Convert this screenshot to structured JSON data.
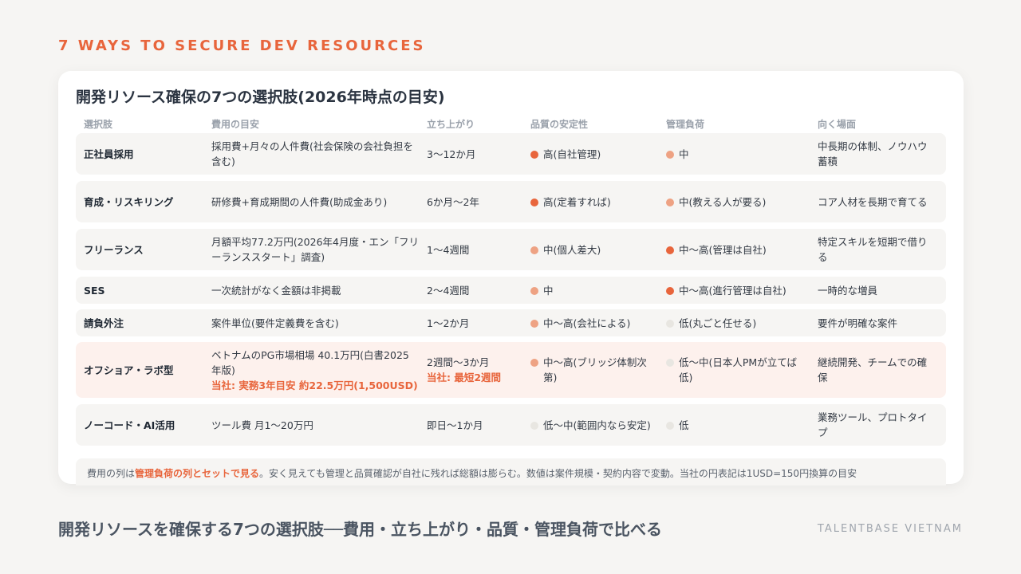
{
  "eyebrow": "7 WAYS TO SECURE DEV RESOURCES",
  "card_title": "開発リソース確保の7つの選択肢(2026年時点の目安)",
  "headers": [
    "選択肢",
    "費用の目安",
    "立ち上がり",
    "品質の安定性",
    "管理負荷",
    "向く場面"
  ],
  "colors": {
    "high": "#e8653c",
    "mid": "#eea283",
    "low": "#e8e6e1",
    "accent": "#e8653c"
  },
  "rows": [
    {
      "name": "正社員採用",
      "cost": "採用費+月々の人件費(社会保険の会社負担を含む)",
      "cost_extra": "",
      "ramp": "3〜12か月",
      "ramp_extra": "",
      "quality": "高(自社管理)",
      "quality_level": "high",
      "load": "中",
      "load_level": "mid",
      "fit": "中長期の体制、ノウハウ蓄積"
    },
    {
      "name": "育成・リスキリング",
      "cost": "研修費+育成期間の人件費(助成金あり)",
      "cost_extra": "",
      "ramp": "6か月〜2年",
      "ramp_extra": "",
      "quality": "高(定着すれば)",
      "quality_level": "high",
      "load": "中(教える人が要る)",
      "load_level": "mid",
      "fit": "コア人材を長期で育てる"
    },
    {
      "name": "フリーランス",
      "cost": "月額平均77.2万円(2026年4月度・エン「フリーランススタート」調査)",
      "cost_extra": "",
      "ramp": "1〜4週間",
      "ramp_extra": "",
      "quality": "中(個人差大)",
      "quality_level": "mid",
      "load": "中〜高(管理は自社)",
      "load_level": "high",
      "fit": "特定スキルを短期で借りる"
    },
    {
      "name": "SES",
      "cost": "一次統計がなく金額は非掲載",
      "cost_extra": "",
      "ramp": "2〜4週間",
      "ramp_extra": "",
      "quality": "中",
      "quality_level": "mid",
      "load": "中〜高(進行管理は自社)",
      "load_level": "high",
      "fit": "一時的な増員"
    },
    {
      "name": "請負外注",
      "cost": "案件単位(要件定義費を含む)",
      "cost_extra": "",
      "ramp": "1〜2か月",
      "ramp_extra": "",
      "quality": "中〜高(会社による)",
      "quality_level": "mid",
      "load": "低(丸ごと任せる)",
      "load_level": "low",
      "fit": "要件が明確な案件"
    },
    {
      "name": "オフショア・ラボ型",
      "cost": "ベトナムのPG市場相場 40.1万円(白書2025年版)",
      "cost_extra": "当社: 実務3年目安 約22.5万円(1,500USD)",
      "ramp": "2週間〜3か月",
      "ramp_extra": "当社: 最短2週間",
      "quality": "中〜高(ブリッジ体制次第)",
      "quality_level": "mid",
      "load": "低〜中(日本人PMが立てば低)",
      "load_level": "low",
      "fit": "継続開発、チームでの確保"
    },
    {
      "name": "ノーコード・AI活用",
      "cost": "ツール費 月1〜20万円",
      "cost_extra": "",
      "ramp": "即日〜1か月",
      "ramp_extra": "",
      "quality": "低〜中(範囲内なら安定)",
      "quality_level": "low",
      "load": "低",
      "load_level": "low",
      "fit": "業務ツール、プロトタイプ"
    }
  ],
  "note": {
    "pre": "費用の列は",
    "bold": "管理負荷の列とセットで見る",
    "post": "。安く見えても管理と品質確認が自社に残れば総額は膨らむ。数値は案件規模・契約内容で変動。当社の円表記は1USD=150円換算の目安"
  },
  "footer_title": "開発リソースを確保する7つの選択肢──費用・立ち上がり・品質・管理負荷で比べる",
  "brand": "TALENTBASE VIETNAM"
}
